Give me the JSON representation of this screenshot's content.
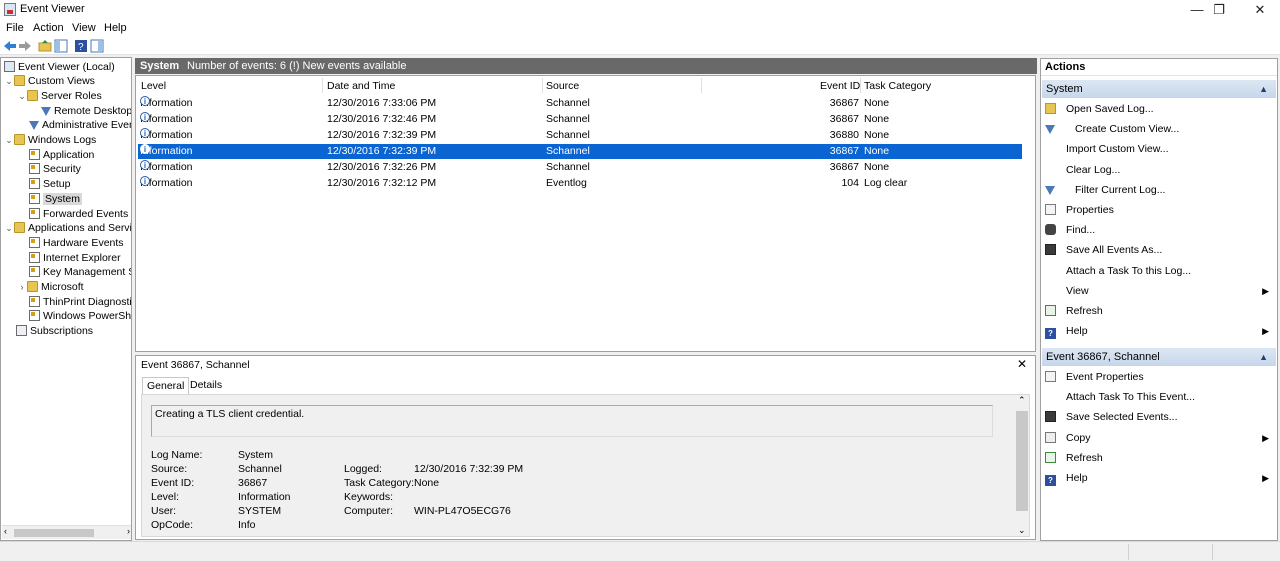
{
  "window": {
    "title": "Event Viewer",
    "controls": {
      "minimize": "—",
      "restore": "❐",
      "close": "✕"
    }
  },
  "menu": [
    "File",
    "Action",
    "View",
    "Help"
  ],
  "tree": {
    "root": "Event Viewer (Local)",
    "custom_views": "Custom Views",
    "server_roles": "Server Roles",
    "remote_desktop": "Remote Desktop",
    "administrative_events": "Administrative Even",
    "windows_logs": "Windows Logs",
    "application": "Application",
    "security": "Security",
    "setup": "Setup",
    "system": "System",
    "forwarded_events": "Forwarded Events",
    "apps_services": "Applications and Servic",
    "hardware_events": "Hardware Events",
    "internet_explorer": "Internet Explorer",
    "key_management": "Key Management Se",
    "microsoft": "Microsoft",
    "thinprint": "ThinPrint Diagnostic",
    "powershell": "Windows PowerShel",
    "subscriptions": "Subscriptions"
  },
  "center": {
    "log_name": "System",
    "summary": "Number of events: 6 (!) New events available"
  },
  "events_table": {
    "columns": [
      "Level",
      "Date and Time",
      "Source",
      "Event ID",
      "Task Category"
    ],
    "rows": [
      {
        "level": "Information",
        "datetime": "12/30/2016 7:33:06 PM",
        "source": "Schannel",
        "event_id": "36867",
        "task": "None"
      },
      {
        "level": "Information",
        "datetime": "12/30/2016 7:32:46 PM",
        "source": "Schannel",
        "event_id": "36867",
        "task": "None"
      },
      {
        "level": "Information",
        "datetime": "12/30/2016 7:32:39 PM",
        "source": "Schannel",
        "event_id": "36880",
        "task": "None"
      },
      {
        "level": "Information",
        "datetime": "12/30/2016 7:32:39 PM",
        "source": "Schannel",
        "event_id": "36867",
        "task": "None"
      },
      {
        "level": "Information",
        "datetime": "12/30/2016 7:32:26 PM",
        "source": "Schannel",
        "event_id": "36867",
        "task": "None"
      },
      {
        "level": "Information",
        "datetime": "12/30/2016 7:32:12 PM",
        "source": "Eventlog",
        "event_id": "104",
        "task": "Log clear"
      }
    ],
    "selected_index": 3
  },
  "detail": {
    "title": "Event 36867, Schannel",
    "tabs": [
      "General",
      "Details"
    ],
    "description": "Creating a TLS client credential.",
    "labels": {
      "log_name": "Log Name:",
      "source": "Source:",
      "event_id": "Event ID:",
      "level": "Level:",
      "user": "User:",
      "opcode": "OpCode:",
      "logged": "Logged:",
      "task_category": "Task Category:",
      "keywords": "Keywords:",
      "computer": "Computer:"
    },
    "values": {
      "log_name": "System",
      "source": "Schannel",
      "event_id": "36867",
      "level": "Information",
      "user": "SYSTEM",
      "opcode": "Info",
      "logged": "12/30/2016 7:32:39 PM",
      "task_category": "None",
      "keywords": "",
      "computer": "WIN-PL47O5ECG76"
    }
  },
  "actions": {
    "header": "Actions",
    "system_section": "System",
    "system_items": [
      "Open Saved Log...",
      "Create Custom View...",
      "Import Custom View...",
      "Clear Log...",
      "Filter Current Log...",
      "Properties",
      "Find...",
      "Save All Events As...",
      "Attach a Task To this Log...",
      "View",
      "Refresh",
      "Help"
    ],
    "event_section": "Event 36867, Schannel",
    "event_items": [
      "Event Properties",
      "Attach Task To This Event...",
      "Save Selected Events...",
      "Copy",
      "Refresh",
      "Help"
    ]
  },
  "colors": {
    "selection": "#0a64d2",
    "center_header": "#696969",
    "section_header": "#c6d6ea"
  }
}
